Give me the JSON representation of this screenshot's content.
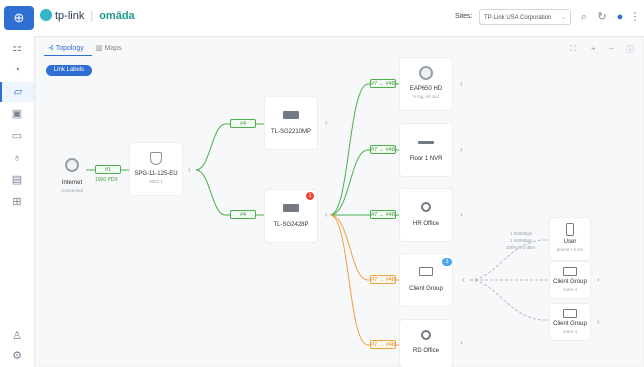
{
  "topbar": {
    "brand_name": "tp-link",
    "brand_product": "omāda",
    "sites_label": "Sites:",
    "site_selected": "TP-Link USA Corporation",
    "icons": [
      "search-icon",
      "refresh-icon",
      "user-icon",
      "more-icon"
    ]
  },
  "sidebar": {
    "icons": [
      "dashboard-icon",
      "statistics-icon",
      "map-icon",
      "devices-icon",
      "clients-icon",
      "insights-icon",
      "logs-icon",
      "reports-icon",
      "account-icon",
      "settings-icon"
    ],
    "active": "map-icon"
  },
  "tabs": [
    {
      "label": "Topology",
      "active": true
    },
    {
      "label": "Maps",
      "active": false
    }
  ],
  "link_labels_button": "Link Labels",
  "toolbar_icons": [
    "fullscreen-icon",
    "zoom-in-icon",
    "zoom-out-icon",
    "info-icon"
  ],
  "nodes": {
    "internet": {
      "label": "Internet",
      "sub": "Connected"
    },
    "gateway": {
      "label": "SPG-11-125-EU",
      "sub": "2001:1"
    },
    "switch1": {
      "label": "TL-SG2210MP"
    },
    "switch2": {
      "label": "TL-SG2428P",
      "alert_count": "1"
    },
    "eap": {
      "label": "EAP650 HD",
      "sub": "5 mg, All Jcd"
    },
    "nvr": {
      "label": "Floor 1 NVR"
    },
    "hr_office": {
      "label": "HR Office"
    },
    "client_group_main": {
      "label": "Client Group",
      "count": "3"
    },
    "rd_office": {
      "label": "RD Office"
    },
    "user": {
      "label": "User",
      "sub": "phone • 4 ms"
    },
    "client_group_a": {
      "label": "Client Group",
      "sub": "more 4"
    },
    "client_group_b": {
      "label": "Client Group",
      "sub": "more 4"
    }
  },
  "links": {
    "internet_gateway": {
      "port": "#1",
      "speed": "1000 PDX"
    },
    "gateway_switch1": "#4",
    "gateway_switch2": "#4",
    "to_eap": "#7 → #48",
    "to_nvr": "#7 → #48",
    "to_hr": "#7 → #48",
    "to_client": "#7 → #48",
    "to_rd": "#7 → #48",
    "wireless_stats": [
      "1 900Mbps",
      "1 400Mbps",
      "100%/1.0 dBm"
    ]
  },
  "colors": {
    "accent": "#2f6fd3",
    "wired_link": "#4cae4c",
    "other_link": "#f0a040",
    "wireless_link": "#b8bcc2",
    "alert": "#e8463a"
  }
}
